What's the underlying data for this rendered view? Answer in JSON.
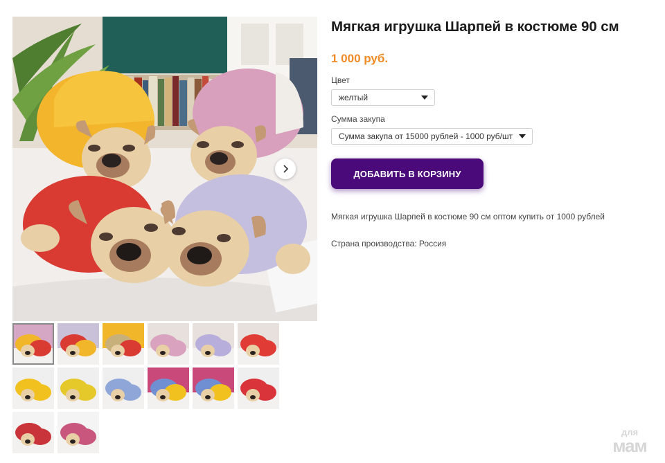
{
  "product": {
    "title": "Мягкая игрушка Шарпей в костюме 90 см",
    "price": "1 000 руб.",
    "color_label": "Цвет",
    "color_value": "желтый",
    "purchase_label": "Сумма закупа",
    "purchase_value": "Сумма закупа от 15000 рублей - 1000 руб/шт",
    "add_to_cart": "ДОБАВИТЬ В КОРЗИНУ",
    "description": "Мягкая игрушка Шарпей в костюме 90 см оптом купить от 1000 рублей",
    "country": "Страна производства: Россия"
  },
  "gallery": {
    "main_alt": "plush pug toys",
    "next_icon": "chevron-right-icon",
    "thumbnails": [
      {
        "theme": [
          "#f2b62a",
          "#d93a32",
          "#d6a7c4"
        ]
      },
      {
        "theme": [
          "#d93a32",
          "#f2b62a",
          "#c9c1d8"
        ]
      },
      {
        "theme": [
          "#c8b07a",
          "#d93a32",
          "#f2b62a"
        ]
      },
      {
        "theme": [
          "#d9a3bf",
          "#d9a3bf",
          "#e7e0dc"
        ]
      },
      {
        "theme": [
          "#b7aedb",
          "#b7aedb",
          "#e7e0dc"
        ]
      },
      {
        "theme": [
          "#e03c35",
          "#e03c35",
          "#e7e0dc"
        ]
      },
      {
        "theme": [
          "#f1c21f",
          "#f1c21f",
          "#efefef"
        ]
      },
      {
        "theme": [
          "#e5c92a",
          "#e5c92a",
          "#efefef"
        ]
      },
      {
        "theme": [
          "#8fa6d8",
          "#8fa6d8",
          "#efefef"
        ]
      },
      {
        "theme": [
          "#6f8fd2",
          "#f1c21f",
          "#c94a7a"
        ]
      },
      {
        "theme": [
          "#6f8fd2",
          "#f1c21f",
          "#c94a7a"
        ]
      },
      {
        "theme": [
          "#d8343a",
          "#d8343a",
          "#efefef"
        ]
      },
      {
        "theme": [
          "#c9343a",
          "#c9343a",
          "#f4f4f4"
        ]
      },
      {
        "theme": [
          "#c8567d",
          "#c8567d",
          "#f4f4f4"
        ]
      }
    ]
  },
  "watermark": {
    "line1": "для",
    "line2": "мам"
  },
  "colors": {
    "accent": "#f08a24",
    "button": "#4a0a7a"
  }
}
